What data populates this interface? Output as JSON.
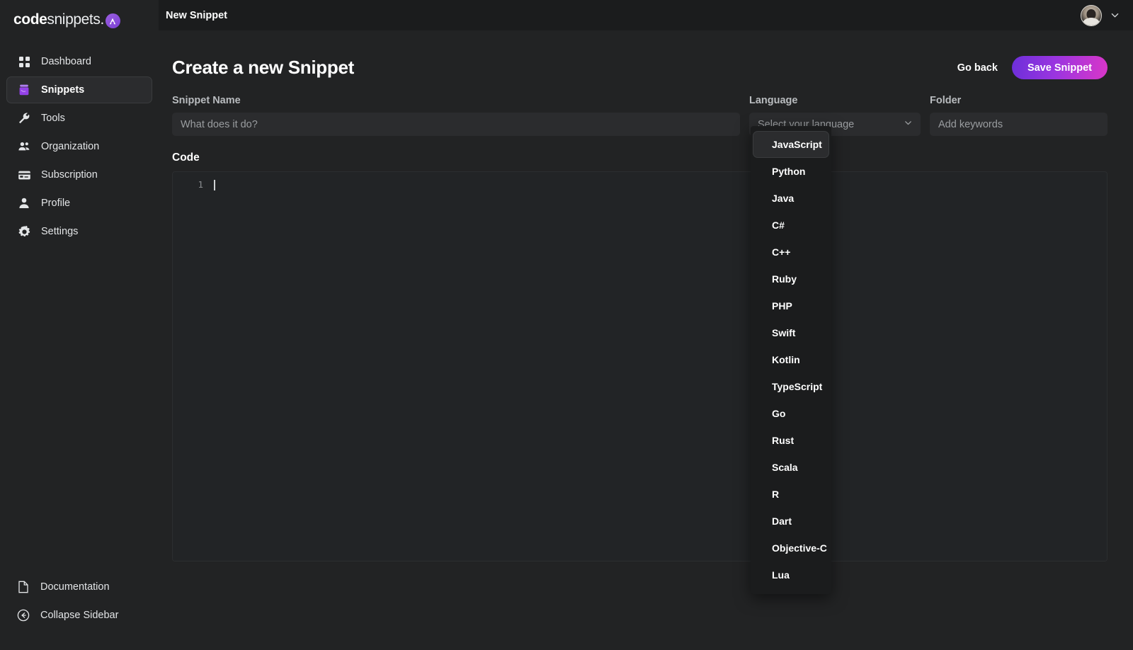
{
  "brand": {
    "name_bold": "code",
    "name_regular": "snippets.",
    "badge_glyph": "A"
  },
  "sidebar": {
    "items": [
      {
        "label": "Dashboard",
        "icon": "grid-icon",
        "active": false
      },
      {
        "label": "Snippets",
        "icon": "snippets-icon",
        "active": true
      },
      {
        "label": "Tools",
        "icon": "wrench-icon",
        "active": false
      },
      {
        "label": "Organization",
        "icon": "people-icon",
        "active": false
      },
      {
        "label": "Subscription",
        "icon": "credit-card-icon",
        "active": false
      },
      {
        "label": "Profile",
        "icon": "person-icon",
        "active": false
      },
      {
        "label": "Settings",
        "icon": "gear-icon",
        "active": false
      }
    ],
    "footer": [
      {
        "label": "Documentation",
        "icon": "document-icon"
      },
      {
        "label": "Collapse Sidebar",
        "icon": "arrow-left-circle-icon"
      }
    ]
  },
  "topbar": {
    "title": "New Snippet",
    "avatar_alt": "user-avatar",
    "chevron": "chevron-down-icon"
  },
  "page": {
    "title": "Create a new Snippet",
    "go_back_label": "Go back",
    "save_label": "Save Snippet"
  },
  "form": {
    "snippet_name": {
      "label": "Snippet Name",
      "placeholder": "What does it do?",
      "value": ""
    },
    "language": {
      "label": "Language",
      "placeholder": "Select your language",
      "value": "",
      "options": [
        "JavaScript",
        "Python",
        "Java",
        "C#",
        "C++",
        "Ruby",
        "PHP",
        "Swift",
        "Kotlin",
        "TypeScript",
        "Go",
        "Rust",
        "Scala",
        "R",
        "Dart",
        "Objective-C",
        "Lua"
      ],
      "highlighted_option": "JavaScript"
    },
    "folder": {
      "label": "Folder",
      "placeholder": "Add keywords",
      "value": ""
    }
  },
  "code": {
    "label": "Code",
    "line_numbers": [
      "1"
    ],
    "content": ""
  },
  "colors": {
    "accent_purple": "#8b3fd9",
    "accent_pink": "#d936c8",
    "sidebar_bg": "#222324",
    "page_bg": "#1b1c1d",
    "input_bg": "#2b2c2e",
    "editor_bg": "#222426"
  }
}
